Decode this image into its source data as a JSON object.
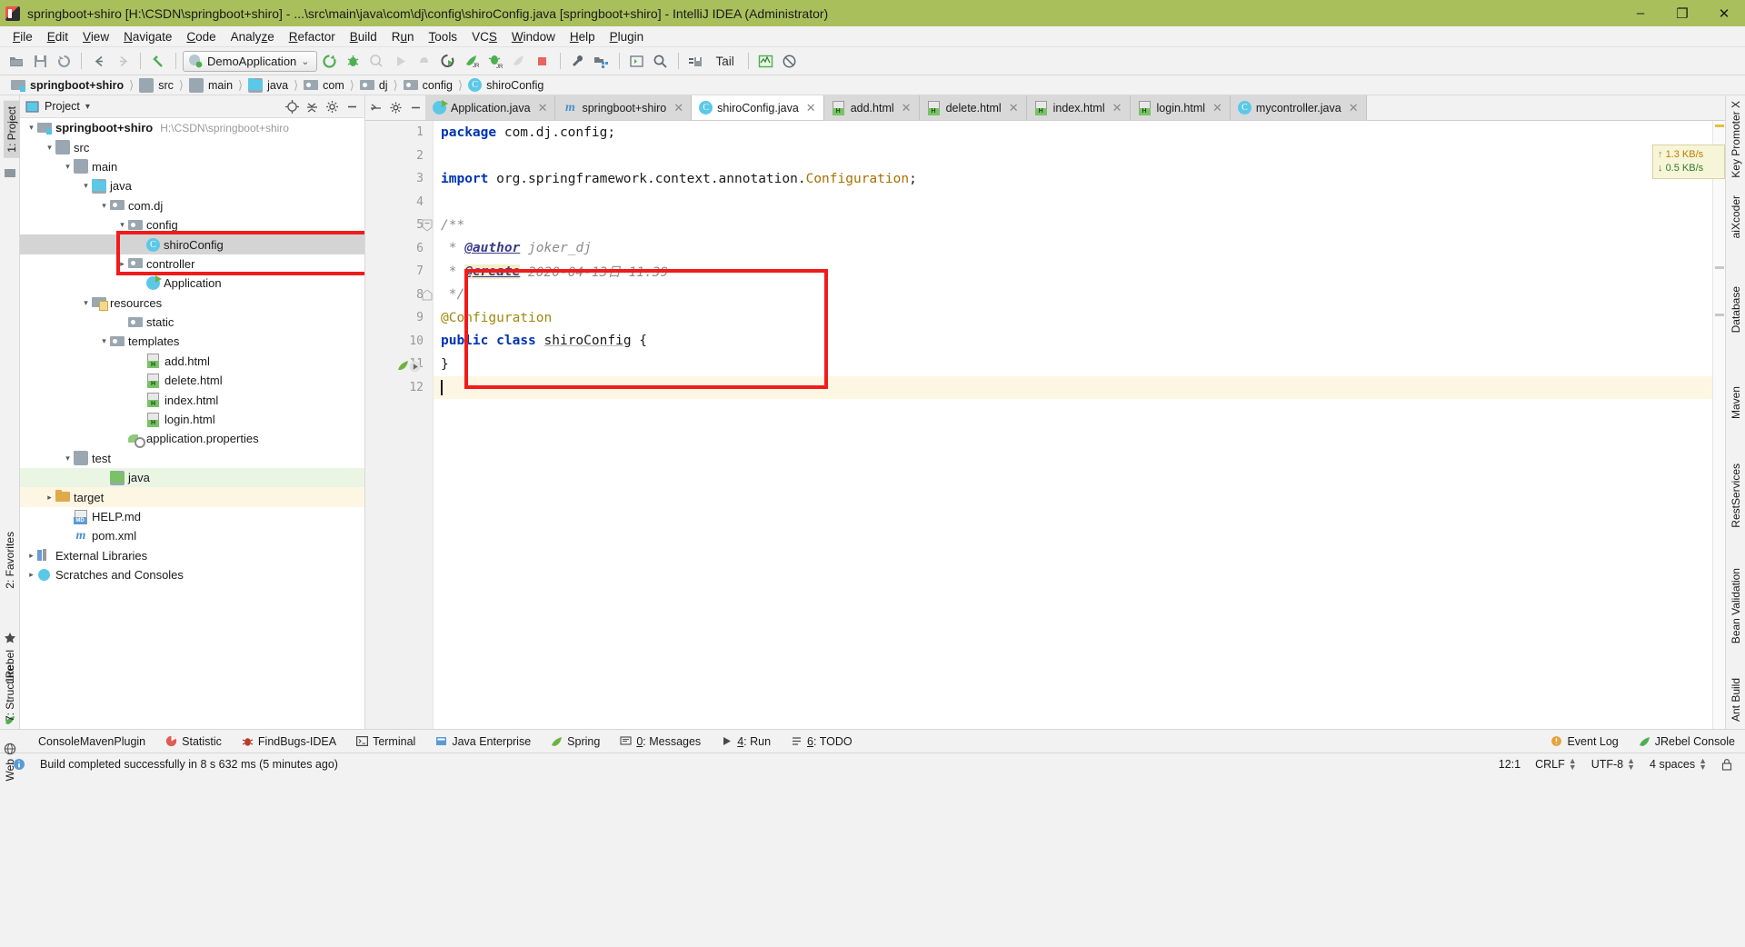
{
  "window": {
    "title": "springboot+shiro [H:\\CSDN\\springboot+shiro] - ...\\src\\main\\java\\com\\dj\\config\\shiroConfig.java [springboot+shiro] - IntelliJ IDEA (Administrator)",
    "minimize": "–",
    "maximize": "❐",
    "close": "✕",
    "titlebar_color": "#a9bf5c"
  },
  "menubar": {
    "items": [
      {
        "label": "File",
        "mnemonic": "F"
      },
      {
        "label": "Edit",
        "mnemonic": "E"
      },
      {
        "label": "View",
        "mnemonic": "V"
      },
      {
        "label": "Navigate",
        "mnemonic": "N"
      },
      {
        "label": "Code",
        "mnemonic": "C"
      },
      {
        "label": "Analyze",
        "mnemonic": "z"
      },
      {
        "label": "Refactor",
        "mnemonic": "R"
      },
      {
        "label": "Build",
        "mnemonic": "B"
      },
      {
        "label": "Run",
        "mnemonic": "u"
      },
      {
        "label": "Tools",
        "mnemonic": "T"
      },
      {
        "label": "VCS",
        "mnemonic": "S"
      },
      {
        "label": "Window",
        "mnemonic": "W"
      },
      {
        "label": "Help",
        "mnemonic": "H"
      },
      {
        "label": "Plugin",
        "mnemonic": "P"
      }
    ]
  },
  "toolbar": {
    "run_configuration": "DemoApplication",
    "dropdown_caret": "⌄",
    "tail_label": "Tail",
    "icons": [
      "open-project-icon",
      "save-all-icon",
      "sync-icon",
      "back-icon",
      "forward-icon",
      "undo-icon",
      "rerun-icon",
      "debug-icon",
      "coverage-icon",
      "run-icon",
      "stop-pause-icon",
      "rerun-jrebel-icon",
      "jrebel-run-icon",
      "jrebel-debug-icon",
      "jrebel-profile-icon",
      "stop-icon",
      "settings-icon",
      "project-structure-icon",
      "terminal-icon",
      "search-everywhere-icon",
      "tail-file-icon",
      "spring-monitor-icon",
      "disabled-icon"
    ]
  },
  "breadcrumb": {
    "items": [
      {
        "label": "springboot+shiro",
        "icon": "module-icon",
        "root": true
      },
      {
        "label": "src",
        "icon": "folder-icon"
      },
      {
        "label": "main",
        "icon": "folder-icon"
      },
      {
        "label": "java",
        "icon": "source-folder-icon"
      },
      {
        "label": "com",
        "icon": "package-icon"
      },
      {
        "label": "dj",
        "icon": "package-icon"
      },
      {
        "label": "config",
        "icon": "package-icon"
      },
      {
        "label": "shiroConfig",
        "icon": "class-icon"
      }
    ]
  },
  "left_strip": {
    "project_label": "1: Project",
    "favorites_label": "2: Favorites",
    "structure_label": "7: Structure",
    "jrebel_label": "JRebel",
    "web_label": "Web"
  },
  "right_strip": {
    "items": [
      "Key Promoter X",
      "aiXcoder",
      "Database",
      "Maven",
      "RestServices",
      "Bean Validation",
      "Ant Build"
    ]
  },
  "project_panel": {
    "title": "Project",
    "dropdown_caret": "▾",
    "header_icons": [
      "locate-icon",
      "collapse-all-icon",
      "settings-icon",
      "hide-icon"
    ],
    "tree": [
      {
        "label": "springboot+shiro",
        "suffix": "H:\\CSDN\\springboot+shiro",
        "icon": "module-icon",
        "depth": 0,
        "arrow": "expanded",
        "bold": true
      },
      {
        "label": "src",
        "icon": "folder-icon",
        "depth": 1,
        "arrow": "expanded"
      },
      {
        "label": "main",
        "icon": "folder-icon",
        "depth": 2,
        "arrow": "expanded"
      },
      {
        "label": "java",
        "icon": "source-folder-icon",
        "depth": 3,
        "arrow": "expanded"
      },
      {
        "label": "com.dj",
        "icon": "package-icon",
        "depth": 4,
        "arrow": "expanded"
      },
      {
        "label": "config",
        "icon": "package-icon",
        "depth": 5,
        "arrow": "expanded"
      },
      {
        "label": "shiroConfig",
        "icon": "class-icon",
        "depth": 6,
        "arrow": "none",
        "selected": true
      },
      {
        "label": "controller",
        "icon": "package-icon",
        "depth": 5,
        "arrow": "collapsed"
      },
      {
        "label": "Application",
        "icon": "spring-class-icon",
        "depth": 5,
        "arrow": "none"
      },
      {
        "label": "resources",
        "icon": "resources-folder-icon",
        "depth": 3,
        "arrow": "expanded"
      },
      {
        "label": "static",
        "icon": "package-icon",
        "depth": 4,
        "arrow": "none"
      },
      {
        "label": "templates",
        "icon": "package-icon",
        "depth": 4,
        "arrow": "expanded"
      },
      {
        "label": "add.html",
        "icon": "html-icon",
        "depth": 5,
        "arrow": "none"
      },
      {
        "label": "delete.html",
        "icon": "html-icon",
        "depth": 5,
        "arrow": "none"
      },
      {
        "label": "index.html",
        "icon": "html-icon",
        "depth": 5,
        "arrow": "none"
      },
      {
        "label": "login.html",
        "icon": "html-icon",
        "depth": 5,
        "arrow": "none"
      },
      {
        "label": "application.properties",
        "icon": "properties-icon",
        "depth": 4,
        "arrow": "none"
      },
      {
        "label": "test",
        "icon": "folder-icon",
        "depth": 2,
        "arrow": "expanded"
      },
      {
        "label": "java",
        "icon": "test-source-folder-icon",
        "depth": 3,
        "arrow": "none",
        "highlight": "green"
      },
      {
        "label": "target",
        "icon": "target-folder-icon",
        "depth": 1,
        "arrow": "collapsed",
        "highlight": "yellow"
      },
      {
        "label": "HELP.md",
        "icon": "markdown-icon",
        "depth": 1,
        "arrow": "none"
      },
      {
        "label": "pom.xml",
        "icon": "maven-icon",
        "depth": 1,
        "arrow": "none"
      },
      {
        "label": "External Libraries",
        "icon": "libraries-icon",
        "depth": 0,
        "arrow": "collapsed"
      },
      {
        "label": "Scratches and Consoles",
        "icon": "scratches-icon",
        "depth": 0,
        "arrow": "collapsed"
      }
    ]
  },
  "editor": {
    "tabs": [
      {
        "label": "Application.java",
        "icon": "spring-class-icon",
        "active": false,
        "close": "✕"
      },
      {
        "label": "springboot+shiro",
        "icon": "maven-icon",
        "active": false,
        "close": "✕"
      },
      {
        "label": "shiroConfig.java",
        "icon": "class-icon",
        "active": true,
        "close": "✕"
      },
      {
        "label": "add.html",
        "icon": "html-icon",
        "active": false,
        "close": "✕"
      },
      {
        "label": "delete.html",
        "icon": "html-icon",
        "active": false,
        "close": "✕"
      },
      {
        "label": "index.html",
        "icon": "html-icon",
        "active": false,
        "close": "✕"
      },
      {
        "label": "login.html",
        "icon": "html-icon",
        "active": false,
        "close": "✕"
      },
      {
        "label": "mycontroller.java",
        "icon": "class-icon",
        "active": false,
        "close": "✕"
      }
    ],
    "line_numbers": [
      "1",
      "2",
      "3",
      "4",
      "5",
      "6",
      "7",
      "8",
      "9",
      "10",
      "11",
      "12"
    ],
    "code": {
      "l1_kw": "package",
      "l1_rest": " com.dj.config;",
      "l3_kw": "import",
      "l3_pkg": " org.springframework.context.annotation.",
      "l3_cls": "Configuration",
      "l3_end": ";",
      "l5": "/**",
      "l6_star": " * ",
      "l6_tag": "@author",
      "l6_val": " joker_dj",
      "l7_star": " * ",
      "l7_tag": "@create",
      "l7_val": " 2020-04-13日 11:39",
      "l8": " */",
      "l9": "@Configuration",
      "l10_kw1": "public",
      "l10_kw2": "class",
      "l10_name": "shiroConfig",
      "l10_brace": "{",
      "l11": "}"
    }
  },
  "network_popup": {
    "upload": "1.3 KB/s",
    "download": "0.5 KB/s",
    "up_arrow": "↑",
    "down_arrow": "↓"
  },
  "tool_windows": {
    "items": [
      {
        "label": "ConsoleMavenPlugin",
        "icon": "console-icon"
      },
      {
        "label": "Statistic",
        "icon": "statistic-icon"
      },
      {
        "label": "FindBugs-IDEA",
        "icon": "findbugs-icon"
      },
      {
        "label": "Terminal",
        "icon": "terminal-icon"
      },
      {
        "label": "Java Enterprise",
        "icon": "java-enterprise-icon"
      },
      {
        "label": "Spring",
        "icon": "spring-icon"
      },
      {
        "label": "0: Messages",
        "icon": "messages-icon",
        "mnemonic": "0"
      },
      {
        "label": "4: Run",
        "icon": "run-icon",
        "mnemonic": "4"
      },
      {
        "label": "6: TODO",
        "icon": "todo-icon",
        "mnemonic": "6"
      }
    ],
    "right_items": [
      {
        "label": "Event Log",
        "icon": "event-log-icon"
      },
      {
        "label": "JRebel Console",
        "icon": "jrebel-icon"
      }
    ]
  },
  "statusbar": {
    "message": "Build completed successfully in 8 s 632 ms (5 minutes ago)",
    "message_icon": "info-icon",
    "caret_position": "12:1",
    "line_separator": "CRLF",
    "encoding": "UTF-8",
    "indent": "4 spaces",
    "lock_icon": "lock-icon",
    "updown_caret": "↕"
  },
  "colors": {
    "titlebar": "#a9bf5c",
    "annotation_box": "#f01b1b",
    "selection": "#d4d4d4",
    "caret_line": "#fdf6e3",
    "keyword": "#0033b3",
    "annotation_text": "#9e880d",
    "class_ref": "#a86f00",
    "comment": "#8c8c8c"
  }
}
